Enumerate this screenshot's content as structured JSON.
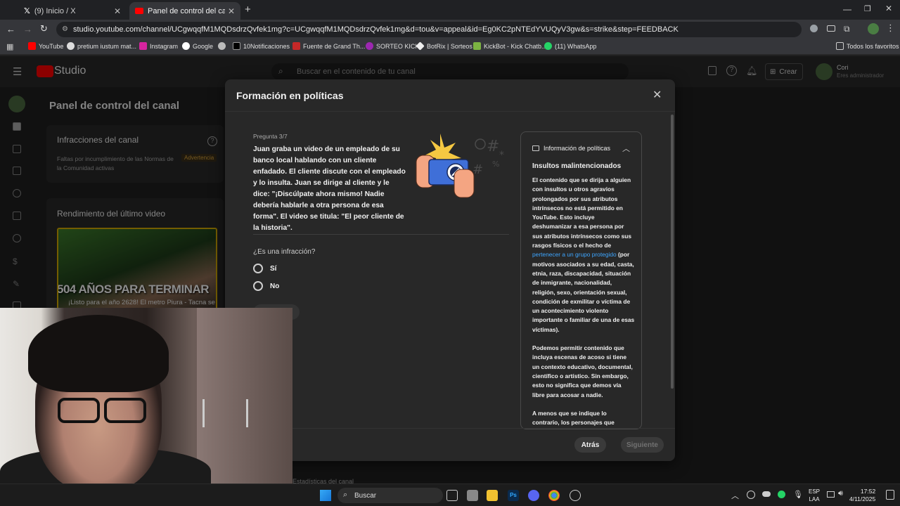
{
  "browser": {
    "tabs": [
      {
        "label": "(9) Inicio / X",
        "active": false
      },
      {
        "label": "Panel de control del canal - You",
        "active": true
      }
    ],
    "url": "studio.youtube.com/channel/UCgwqqfM1MQDsdrzQvfek1mg?c=UCgwqqfM1MQDsdrzQvfek1mg&d=tou&v=appeal&id=Eg0KC2pNTEdYVUQyV3gw&s=strike&step=FEEDBACK",
    "bookmarks": [
      "YouTube",
      "pretium iustum mat...",
      "Instagram",
      "Google",
      "10Notificaciones",
      "Fuente de Grand Th...",
      "SORTEO KICK",
      "BotRix | Sorteos",
      "KickBot - Kick Chatb...",
      "(11) WhatsApp"
    ],
    "all_bookmarks": "Todos los favoritos"
  },
  "studio": {
    "logo": "Studio",
    "search_placeholder": "Buscar en el contenido de tu canal",
    "create_label": "Crear",
    "account_name": "Cori",
    "account_role": "Eres administrador",
    "page_title": "Panel de control del canal",
    "violations_card": {
      "title": "Infracciones del canal",
      "subtitle": "Faltas por incumplimiento de las Normas de la Comunidad activas",
      "badge": "Advertencia"
    },
    "last_video_card": {
      "title": "Rendimiento del último video",
      "thumb_text": "504 AÑOS PARA TERMINAR",
      "video_title": "¡Listo para el año 2628! El metro Piura - Tacna se inaugura | Cablinaisne"
    },
    "bottom_text_1": "...",
    "bottom_text_2": "Estadísticas del canal"
  },
  "modal": {
    "title": "Formación en políticas",
    "question_label": "Pregunta 3/7",
    "question_text": "Juan graba un video de un empleado de su banco local hablando con un cliente enfadado. El cliente discute con el empleado y lo insulta. Juan se dirige al cliente y le dice: \"¡Discúlpate ahora mismo! Nadie debería hablarle a otra persona de esa forma\". El video se titula: \"El peor cliente de la historia\".",
    "is_violation": "¿Es una infracción?",
    "options": [
      "Sí",
      "No"
    ],
    "policy": {
      "header": "Información de políticas",
      "title": "Insultos malintencionados",
      "p1_before": "El contenido que se dirija a alguien con insultos u otros agravios prolongados por sus atributos intrínsecos no está permitido en YouTube. Esto incluye deshumanizar a esa persona por sus atributos intrínsecos como sus rasgos físicos o el hecho de",
      "p1_link": "pertenecer a un grupo protegido",
      "p1_after": "(por motivos asociados a su edad, casta, etnia, raza, discapacidad, situación de inmigrante, nacionalidad, religión, sexo, orientación sexual, condición de exmilitar o víctima de un acontecimiento violento importante o familiar de una de esas víctimas).",
      "p2": "Podemos permitir contenido que incluya escenas de acoso si tiene un contexto educativo, documental, científico o artístico. Sin embargo, esto no significa que demos vía libre para acosar a nadie.",
      "p3": "A menos que se indique lo contrario, los personajes que aparecen en"
    },
    "back_label": "Atrás",
    "next_label": "Siguiente"
  },
  "taskbar": {
    "search": "Buscar",
    "lang_1": "ESP",
    "lang_2": "LAA",
    "time": "17:52",
    "date": "4/11/2025"
  },
  "colors": {
    "youtube_red": "#ff0000",
    "link_blue": "#3ea6ff",
    "modal_bg": "#282828",
    "warning_badge": "#7a5a1c"
  }
}
